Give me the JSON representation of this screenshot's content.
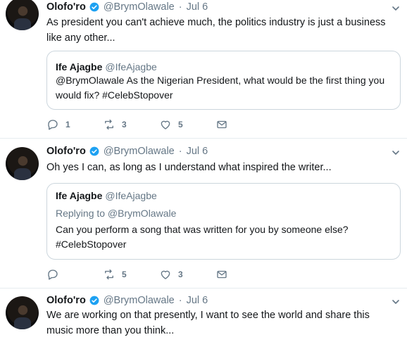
{
  "tweets": [
    {
      "author_name": "Olofo'ro",
      "author_handle": "@BrymOlawale",
      "separator": "·",
      "time": "Jul 6",
      "text": "As president you can't achieve much, the politics industry is just a business like any other...",
      "quote": {
        "name": "Ife Ajagbe",
        "handle": "@IfeAjagbe",
        "replying_to": "",
        "text": "@BrymOlawale As the Nigerian President, what would be the first thing you would fix? #CelebStopover"
      },
      "reply_count": "1",
      "retweet_count": "3",
      "like_count": "5"
    },
    {
      "author_name": "Olofo'ro",
      "author_handle": "@BrymOlawale",
      "separator": "·",
      "time": "Jul 6",
      "text": "Oh yes I can, as long as I understand what inspired the writer...",
      "quote": {
        "name": "Ife Ajagbe",
        "handle": "@IfeAjagbe",
        "replying_to": "Replying to @BrymOlawale",
        "text": "Can you perform a song that was written for you by someone else? #CelebStopover"
      },
      "reply_count": "",
      "retweet_count": "5",
      "like_count": "3"
    },
    {
      "author_name": "Olofo'ro",
      "author_handle": "@BrymOlawale",
      "separator": "·",
      "time": "Jul 6",
      "text": "We are working on that presently, I want to see the world and share this music more than you think...",
      "quote": null,
      "reply_count": "",
      "retweet_count": "",
      "like_count": ""
    }
  ],
  "colors": {
    "verified_badge": "#1da1f2",
    "secondary_text": "#657786",
    "border": "#e6ecf0"
  },
  "icons": [
    "verified-badge-icon",
    "chevron-down-icon",
    "reply-icon",
    "retweet-icon",
    "like-icon",
    "direct-message-icon"
  ]
}
